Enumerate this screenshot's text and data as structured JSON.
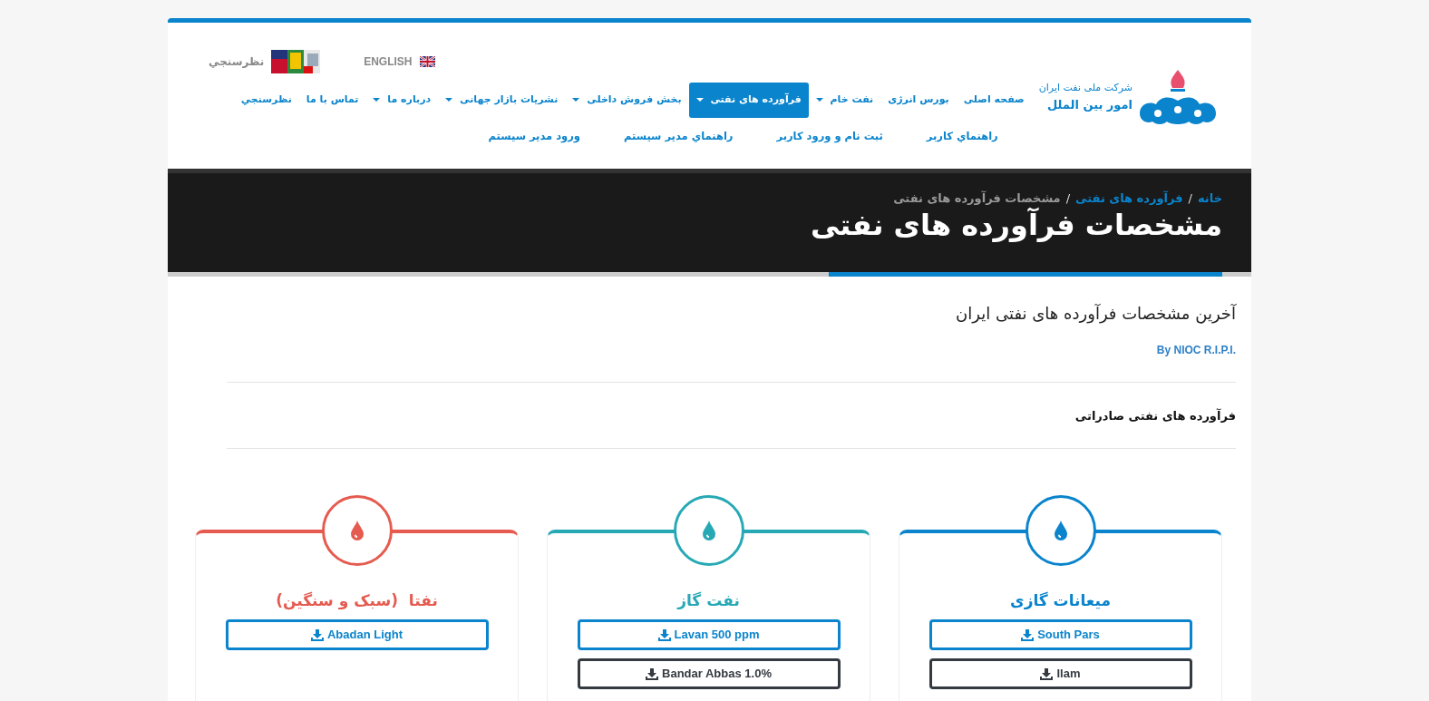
{
  "header": {
    "top_links": [
      {
        "kind": "language",
        "label": "ENGLISH"
      },
      {
        "kind": "survey",
        "label": "نظرسنجي"
      }
    ],
    "logo": {
      "line_1": "شرکت ملی نفت ایران",
      "line_2": "امور بین الملل"
    },
    "nav": [
      {
        "label": "صفحه اصلی",
        "dropdown": false,
        "selected": false
      },
      {
        "label": "بورس انرژی",
        "dropdown": false,
        "selected": false
      },
      {
        "label": "نفت خام",
        "dropdown": true,
        "selected": false
      },
      {
        "label": "فرآورده های نفتی",
        "dropdown": true,
        "selected": true
      },
      {
        "label": "بخش فروش داخلی",
        "dropdown": true,
        "selected": false
      },
      {
        "label": "نشریات بازار جهانی",
        "dropdown": true,
        "selected": false
      },
      {
        "label": "درباره ما",
        "dropdown": true,
        "selected": false
      },
      {
        "label": "تماس با ما",
        "dropdown": false,
        "selected": false
      },
      {
        "label": "نظرسنجي",
        "dropdown": false,
        "selected": false
      }
    ],
    "subnav": [
      "راهنماي کاربر",
      "ثبت نام و ورود کاربر",
      "راهنماي مدير سيستم",
      "ورود مدير سيستم"
    ]
  },
  "page_header": {
    "breadcrumb": [
      {
        "label": "خانه",
        "current": false
      },
      {
        "label": "فرآورده های نفتی",
        "current": false
      },
      {
        "label": "مشخصات فرآورده های نفتی",
        "current": true
      }
    ],
    "separator": "/",
    "title": "مشخصات فرآورده های نفتی"
  },
  "content": {
    "heading": "آخرین مشخصات فرآورده های نفتی ایران",
    "byline": "By NIOC R.I.P.I.",
    "section_title": "فرآورده های نفتی صادراتی"
  },
  "cards": [
    {
      "title": "میعانات گازی",
      "color": "#0a84cc",
      "buttons": [
        {
          "label": "South Pars",
          "color": "#0a84cc"
        },
        {
          "label": "Ilam",
          "color": "#343a40"
        }
      ]
    },
    {
      "title": "نفت گاز",
      "color": "#27a9b5",
      "buttons": [
        {
          "label": "Lavan 500 ppm",
          "color": "#0a84cc"
        },
        {
          "label": "Bandar Abbas 1.0%",
          "color": "#343a40"
        }
      ]
    },
    {
      "title": "نفتا  (سبک و سنگین)",
      "color": "#e55b50",
      "buttons": [
        {
          "label": "Abadan Light",
          "color": "#0a84cc"
        }
      ]
    }
  ]
}
